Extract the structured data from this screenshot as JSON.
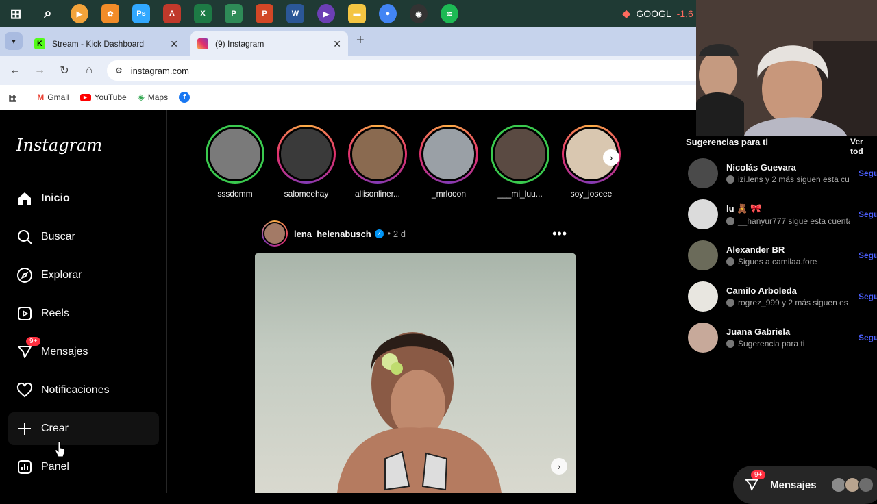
{
  "taskbar": {
    "apps": [
      {
        "name": "windows-start-icon",
        "color": "#ffffff",
        "glyph": "⊞"
      },
      {
        "name": "search-icon",
        "color": "#ffffff",
        "glyph": "⌕"
      },
      {
        "name": "media-player-icon",
        "color": "#f2a33a",
        "glyph": "▶"
      },
      {
        "name": "fl-studio-icon",
        "color": "#f28c28",
        "glyph": "✿"
      },
      {
        "name": "photoshop-icon",
        "color": "#31a8ff",
        "glyph": "Ps"
      },
      {
        "name": "access-icon",
        "color": "#c0392b",
        "glyph": "A"
      },
      {
        "name": "excel-icon",
        "color": "#1d7a45",
        "glyph": "X"
      },
      {
        "name": "project-icon",
        "color": "#2e8b57",
        "glyph": "P"
      },
      {
        "name": "powerpoint-icon",
        "color": "#d24726",
        "glyph": "P"
      },
      {
        "name": "word-icon",
        "color": "#2b5797",
        "glyph": "W"
      },
      {
        "name": "video-player-icon",
        "color": "#6c3fb5",
        "glyph": "▶"
      },
      {
        "name": "file-explorer-icon",
        "color": "#f4c542",
        "glyph": "▬"
      },
      {
        "name": "chrome-icon",
        "color": "#4285f4",
        "glyph": "●"
      },
      {
        "name": "obs-icon",
        "color": "#333333",
        "glyph": "◉"
      },
      {
        "name": "spotify-icon",
        "color": "#1db954",
        "glyph": "≋"
      }
    ],
    "stock": {
      "ticker": "GOOGL",
      "delta": "-1,6"
    }
  },
  "browser": {
    "tabs": [
      {
        "title": "Stream - Kick Dashboard",
        "active": false,
        "fav_color": "#53fc18"
      },
      {
        "title": "(9) Instagram",
        "active": true,
        "fav_color": "#e1306c"
      }
    ],
    "url": "instagram.com",
    "bookmarks": [
      "Gmail",
      "YouTube",
      "Maps"
    ]
  },
  "sidebar": {
    "logo": "Instagram",
    "items": [
      {
        "label": "Inicio",
        "icon": "home-icon",
        "bold": true
      },
      {
        "label": "Buscar",
        "icon": "search-icon"
      },
      {
        "label": "Explorar",
        "icon": "compass-icon"
      },
      {
        "label": "Reels",
        "icon": "reels-icon"
      },
      {
        "label": "Mensajes",
        "icon": "messenger-icon",
        "badge": "9+"
      },
      {
        "label": "Notificaciones",
        "icon": "heart-icon"
      },
      {
        "label": "Crear",
        "icon": "plus-icon",
        "hovered": true
      },
      {
        "label": "Panel",
        "icon": "chart-icon"
      }
    ]
  },
  "stories": [
    {
      "name": "sssdomm",
      "ring": "green",
      "color": "#7a7a7a"
    },
    {
      "name": "salomeehay",
      "ring": "gradient",
      "color": "#3a3a3a"
    },
    {
      "name": "allisonliner...",
      "ring": "gradient",
      "color": "#8a6a50"
    },
    {
      "name": "_mrlooon",
      "ring": "gradient",
      "color": "#9aa0a6"
    },
    {
      "name": "___mi_luu...",
      "ring": "green",
      "color": "#5a4a42"
    },
    {
      "name": "soy_joseee",
      "ring": "gradient",
      "color": "#d9c7b0"
    }
  ],
  "post": {
    "username": "lena_helenabusch",
    "time": "2 d",
    "separator": "•"
  },
  "suggestions": {
    "title": "Sugerencias para ti",
    "see_all": "Ver tod",
    "follow_label": "Segu",
    "items": [
      {
        "name": "Nicolás Guevara",
        "sub": "izi.lens y 2 más siguen esta cu",
        "color": "#4a4a4a"
      },
      {
        "name": "lu 🧸 🎀",
        "sub": "__hanyur777 sigue esta cuenta",
        "color": "#dbdbdb"
      },
      {
        "name": "Alexander BR",
        "sub": "Sigues a camilaa.fore",
        "color": "#6b6b5a"
      },
      {
        "name": "Camilo Arboleda",
        "sub": "rogrez_999 y 2 más siguen es",
        "color": "#e8e6e0"
      },
      {
        "name": "Juana Gabriela",
        "sub": "Sugerencia para ti",
        "color": "#c7a99a"
      }
    ]
  },
  "messages_pill": {
    "label": "Mensajes",
    "badge": "9+"
  }
}
